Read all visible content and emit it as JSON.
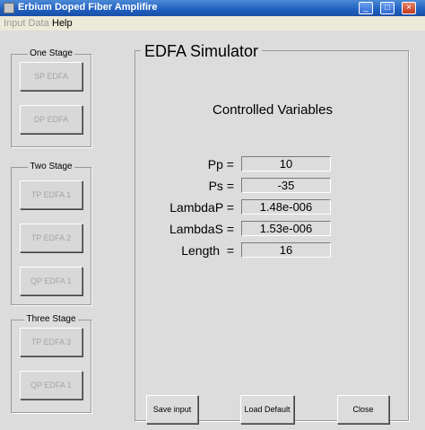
{
  "window": {
    "title": "Erbium Doped Fiber Amplifire",
    "minimize_glyph": "_",
    "maximize_glyph": "□",
    "close_glyph": "×"
  },
  "menu": {
    "items": [
      {
        "label": "Input Data",
        "enabled": false
      },
      {
        "label": "Help",
        "enabled": true
      }
    ]
  },
  "sidebar": {
    "groups": [
      {
        "title": "One Stage",
        "buttons": [
          {
            "label": "SP EDFA",
            "enabled": false
          },
          {
            "label": "DP EDFA",
            "enabled": false
          }
        ]
      },
      {
        "title": "Two Stage",
        "buttons": [
          {
            "label": "TP EDFA 1",
            "enabled": false
          },
          {
            "label": "TP EDFA 2",
            "enabled": false
          },
          {
            "label": "QP EDFA 1",
            "enabled": false
          }
        ]
      },
      {
        "title": "Three Stage",
        "buttons": [
          {
            "label": "TP EDFA 3",
            "enabled": false
          },
          {
            "label": "QP EDFA 1",
            "enabled": false
          }
        ]
      }
    ]
  },
  "main": {
    "title": "EDFA Simulator",
    "section_title": "Controlled Variables",
    "variables": [
      {
        "label": "Pp =",
        "value": "10"
      },
      {
        "label": "Ps =",
        "value": "-35"
      },
      {
        "label": "LambdaP =",
        "value": "1.48e-006"
      },
      {
        "label": "LambdaS =",
        "value": "1.53e-006"
      },
      {
        "label": "Length  =",
        "value": "16"
      }
    ],
    "buttons": {
      "save": "Save input",
      "load_default": "Load Default",
      "close": "Close"
    }
  }
}
